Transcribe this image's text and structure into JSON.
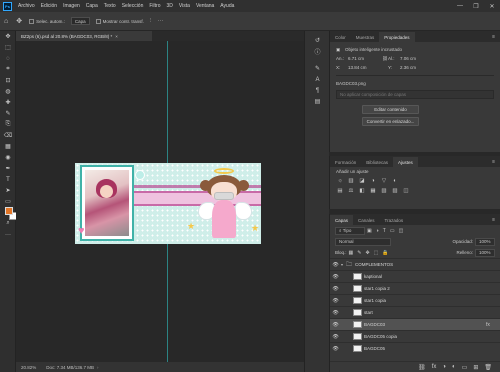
{
  "app": {
    "logo": "Ps"
  },
  "menu": [
    "Archivo",
    "Edición",
    "Imagen",
    "Capa",
    "Texto",
    "Selección",
    "Filtro",
    "3D",
    "Vista",
    "Ventana",
    "Ayuda"
  ],
  "window_controls": {
    "minimize": "—",
    "maximize": "❐",
    "close": "✕"
  },
  "options": {
    "autoselect_label": "Selec. autom.:",
    "autoselect_value": "Capa",
    "transform_label": "Mostrar contr. transf.",
    "more": "···"
  },
  "document_tab": {
    "title": "BZ2ps (6).psd al 20.8% (BAGDC03, RGB/8) *",
    "close": "×"
  },
  "status": {
    "zoom": "20.82%",
    "doc_info": "Doc: 7.34 MB/136.7 MB",
    "arrow": "›"
  },
  "icons": {
    "home": "⌂",
    "move": "✥",
    "align": "⫶",
    "more": "…",
    "history": "↺",
    "info": "ⓘ",
    "brush": "✎",
    "chars": "A",
    "para": "¶",
    "glyph": "▤",
    "layers": "◫",
    "options": "≡"
  },
  "tools": [
    "✥",
    "⬚",
    "◌",
    "⌗",
    "⊡",
    "◍",
    "✚",
    "✎",
    "⎘",
    "⌫",
    "▦",
    "◉",
    "✒",
    "T",
    "➤",
    "▭",
    "✋",
    "⌕",
    "···",
    "⬚"
  ],
  "properties_panel": {
    "tabs": [
      "Color",
      "Muestras",
      "Propiedades"
    ],
    "active_tab": "Propiedades",
    "object_type": "Objeto inteligente incrustado",
    "an_label": "An.:",
    "an_value": "6.71 cm",
    "al_label": "Al.:",
    "al_value": "7.06 cm",
    "x_label": "X:",
    "x_value": "13.84 cm",
    "y_label": "Y:",
    "y_value": "2.36 cm",
    "file_name": "BAGDC03.png",
    "comp_placeholder": "No aplicar composición de capas",
    "edit_button": "Editar contenido",
    "convert_button": "Convertir en enlazado..."
  },
  "adjustments_panel": {
    "tabs": [
      "Formación",
      "Bibliotecas",
      "Ajustes"
    ],
    "active_tab": "Ajustes",
    "add_label": "Añadir un ajuste",
    "icons_row1": [
      "☼",
      "▥",
      "◪",
      "◑",
      "▽",
      "◐"
    ],
    "icons_row2": [
      "▤",
      "⚖",
      "◧",
      "▦",
      "▧",
      "▨",
      "◫"
    ],
    "icons_row3": [
      "◩",
      "◪",
      "▣",
      "◆",
      "▩"
    ]
  },
  "layers_panel": {
    "tabs": [
      "Capas",
      "Canales",
      "Trazados"
    ],
    "active_tab": "Capas",
    "filter_label": "Tipo",
    "blend_mode": "Normal",
    "opacity_label": "Opacidad:",
    "opacity_value": "100%",
    "lock_label": "Bloq.:",
    "fill_label": "Relleno:",
    "fill_value": "100%",
    "layers": [
      {
        "name": "COMPLEMENTOS",
        "type": "group",
        "visible": true,
        "selected": false
      },
      {
        "name": "kaptional",
        "type": "layer",
        "visible": true,
        "selected": false
      },
      {
        "name": "star1 copia 2",
        "type": "layer",
        "visible": true,
        "selected": false
      },
      {
        "name": "star1 copia",
        "type": "layer",
        "visible": true,
        "selected": false
      },
      {
        "name": "start",
        "type": "layer",
        "visible": true,
        "selected": false
      },
      {
        "name": "BAGDC03",
        "type": "layer",
        "visible": true,
        "selected": true,
        "fx": "fx"
      },
      {
        "name": "BAGDC05 copia",
        "type": "layer",
        "visible": true,
        "selected": false
      },
      {
        "name": "BAGDC05",
        "type": "layer",
        "visible": true,
        "selected": false
      }
    ],
    "footer_icons": [
      "⛓",
      "fx",
      "◑",
      "◐",
      "▭",
      "⊞",
      "🗑"
    ]
  }
}
